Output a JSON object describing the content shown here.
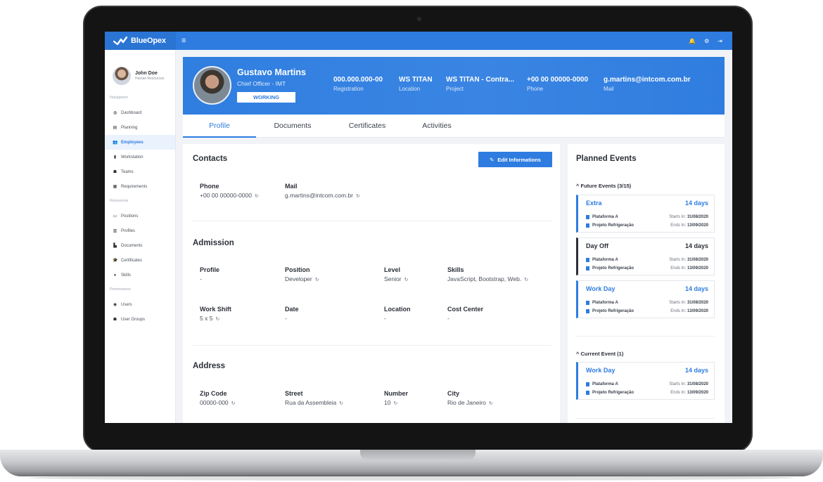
{
  "brand": {
    "name": "BlueOpex",
    "menu_icon": "≡"
  },
  "topbar": {
    "icons": [
      "bell-icon",
      "gear-icon",
      "logout-icon"
    ],
    "bell": "🔔",
    "gear": "⚙",
    "logout": "⇥"
  },
  "user": {
    "name": "John Doe",
    "role": "Human Resources"
  },
  "sidebar": {
    "sections": {
      "navigation": "Navigation",
      "resources": "Resources",
      "permissions": "Permissions"
    },
    "navigation": [
      {
        "label": "Dashboard",
        "icon": "◍"
      },
      {
        "label": "Planning",
        "icon": "▤"
      },
      {
        "label": "Employees",
        "icon": "👥"
      },
      {
        "label": "Workstation",
        "icon": "▮"
      },
      {
        "label": "Teams",
        "icon": "☗"
      },
      {
        "label": "Requirements",
        "icon": "▦"
      }
    ],
    "resources": [
      {
        "label": "Positions",
        "icon": "▭"
      },
      {
        "label": "Profiles",
        "icon": "▥"
      },
      {
        "label": "Documents",
        "icon": "▙"
      },
      {
        "label": "Certificates",
        "icon": "🎓"
      },
      {
        "label": "Skills",
        "icon": "♦"
      }
    ],
    "permissions": [
      {
        "label": "Users",
        "icon": "◉"
      },
      {
        "label": "User Groups",
        "icon": "☗"
      }
    ]
  },
  "employee": {
    "name": "Gustavo Martins",
    "title": "Chief Officer - IMT",
    "status": "WORKING",
    "fields": [
      {
        "value": "000.000.000-00",
        "label": "Registration"
      },
      {
        "value": "WS TITAN",
        "label": "Location"
      },
      {
        "value": "WS TITAN - Contra...",
        "label": "Project"
      },
      {
        "value": "+00 00 00000-0000",
        "label": "Phone"
      },
      {
        "value": "g.martins@intcom.com.br",
        "label": "Mail"
      }
    ]
  },
  "tabs": [
    "Profile",
    "Documents",
    "Certificates",
    "Activities"
  ],
  "contacts": {
    "title": "Contacts",
    "edit_button": "Edit Informations",
    "phone_label": "Phone",
    "phone_value": "+00 00 00000-0000",
    "mail_label": "Mail",
    "mail_value": "g.martins@intcom.com.br"
  },
  "admission": {
    "title": "Admission",
    "fields": [
      {
        "label": "Profile",
        "value": "-"
      },
      {
        "label": "Position",
        "value": "Developer"
      },
      {
        "label": "Level",
        "value": "Senior"
      },
      {
        "label": "Skills",
        "value": "JavaScript, Bootstrap, Web."
      },
      {
        "label": "Work Shift",
        "value": "5 x 5"
      },
      {
        "label": "Date",
        "value": "-"
      },
      {
        "label": "Location",
        "value": "-"
      },
      {
        "label": "Cost Center",
        "value": "-"
      }
    ]
  },
  "address": {
    "title": "Address",
    "fields": [
      {
        "label": "Zip Code",
        "value": "00000-000"
      },
      {
        "label": "Street",
        "value": "Rua da Assembleia"
      },
      {
        "label": "Number",
        "value": "10"
      },
      {
        "label": "City",
        "value": "Rio de Janeiro"
      }
    ]
  },
  "history_icon": "↻",
  "planned_events": {
    "title": "Planned Events",
    "future_label": "Future Events (3/15)",
    "current_label": "Current Event (1)",
    "caret": "^",
    "starts_prefix": "Starts In:",
    "ends_prefix": "Ends In:",
    "events": [
      {
        "name": "Extra",
        "days": "14 days",
        "place": "Plataforma A",
        "project": "Projeto Refrigeração",
        "starts": "31/08/2020",
        "ends": "13/09/2020"
      },
      {
        "name": "Day Off",
        "days": "14 days",
        "place": "Plataforma A",
        "project": "Projeto Refrigeração",
        "starts": "31/08/2020",
        "ends": "13/09/2020"
      },
      {
        "name": "Work Day",
        "days": "14 days",
        "place": "Plataforma A",
        "project": "Projeto Refrigeração",
        "starts": "31/08/2020",
        "ends": "13/09/2020"
      }
    ],
    "current": {
      "name": "Work Day",
      "days": "14 days",
      "place": "Plataforma A",
      "project": "Projeto Refrigeração",
      "starts": "31/08/2020",
      "ends": "13/09/2020"
    }
  },
  "colors": {
    "accent": "#2e7ce0",
    "dark": "#2b2f38"
  }
}
